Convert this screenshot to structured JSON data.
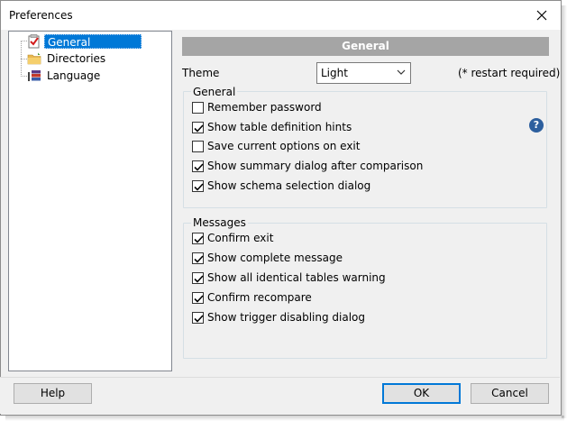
{
  "window": {
    "title": "Preferences"
  },
  "tree": {
    "items": [
      {
        "label": "General",
        "icon": "general-checklist-icon",
        "selected": true
      },
      {
        "label": "Directories",
        "icon": "folder-icon",
        "selected": false
      },
      {
        "label": "Language",
        "icon": "language-icon",
        "selected": false
      }
    ]
  },
  "panel": {
    "header": "General",
    "theme_label": "Theme",
    "theme_value": "Light",
    "restart_note": "(* restart required)",
    "general_group": {
      "title": "General",
      "options": [
        {
          "label": "Remember password",
          "checked": false
        },
        {
          "label": "Show table definition hints",
          "checked": true
        },
        {
          "label": "Save current options on exit",
          "checked": false
        },
        {
          "label": "Show summary dialog after comparison",
          "checked": true
        },
        {
          "label": "Show schema selection dialog",
          "checked": true
        }
      ]
    },
    "messages_group": {
      "title": "Messages",
      "options": [
        {
          "label": "Confirm exit",
          "checked": true
        },
        {
          "label": "Show complete message",
          "checked": true
        },
        {
          "label": "Show all identical tables warning",
          "checked": true
        },
        {
          "label": "Confirm recompare",
          "checked": true
        },
        {
          "label": "Show trigger disabling dialog",
          "checked": true
        }
      ]
    },
    "help_glyph": "?"
  },
  "footer": {
    "help": "Help",
    "ok": "OK",
    "cancel": "Cancel"
  },
  "colors": {
    "accent": "#0078d7",
    "header_bg": "#a5a5a5",
    "help_icon": "#2d5f9e"
  }
}
